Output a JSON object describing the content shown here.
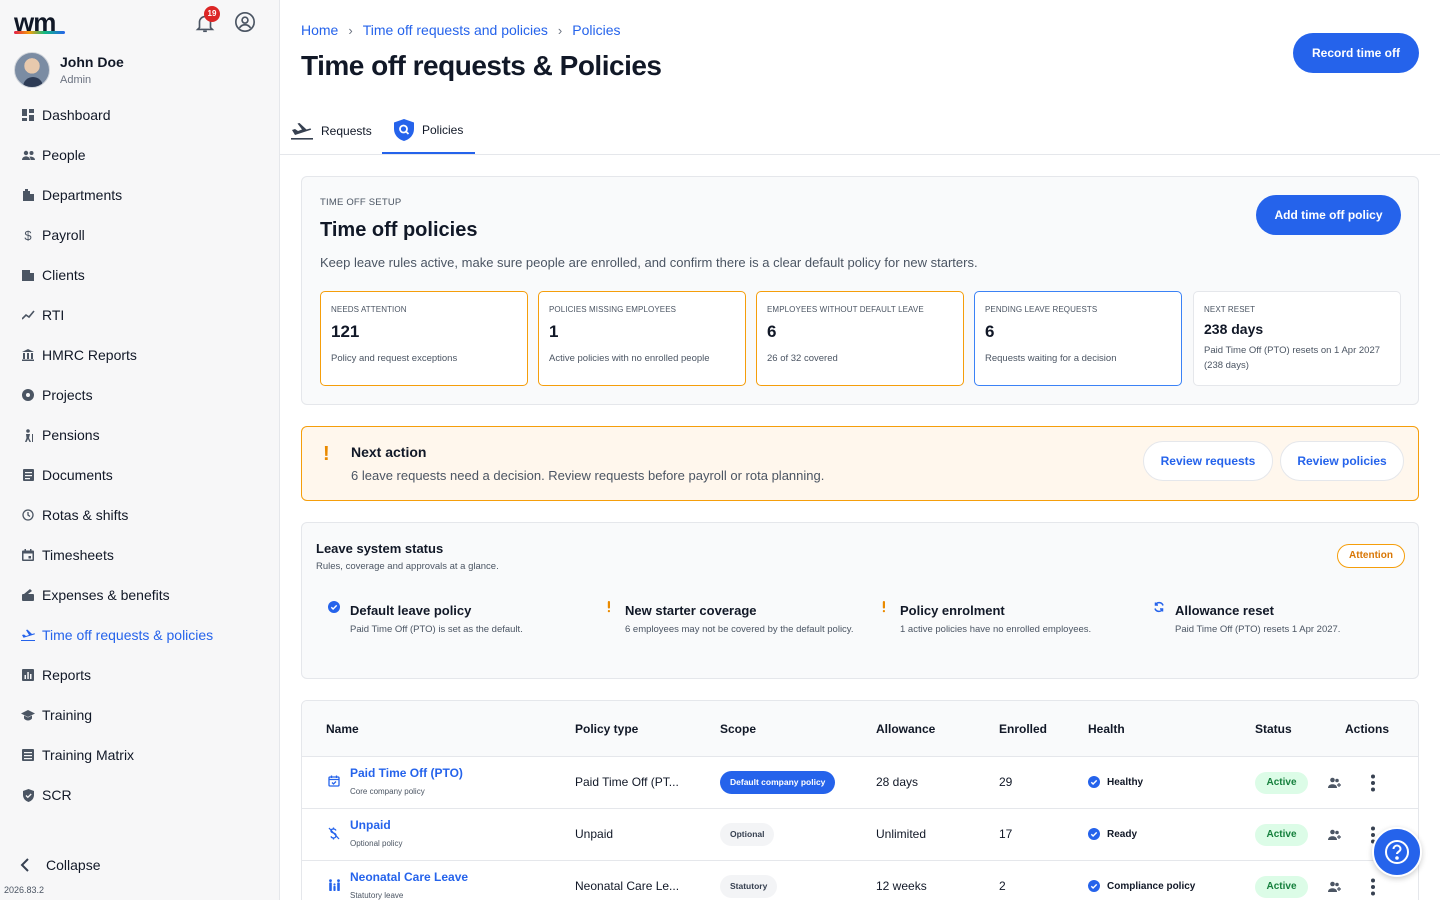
{
  "app": {
    "logo": "wm",
    "notifications_count": "19",
    "version": "2026.83.2"
  },
  "user": {
    "name": "John Doe",
    "role": "Admin"
  },
  "sidebar": {
    "items": [
      {
        "label": "Dashboard",
        "icon": "dashboard-icon"
      },
      {
        "label": "People",
        "icon": "people-icon"
      },
      {
        "label": "Departments",
        "icon": "building-icon"
      },
      {
        "label": "Payroll",
        "icon": "dollar-icon"
      },
      {
        "label": "Clients",
        "icon": "clients-icon"
      },
      {
        "label": "RTI",
        "icon": "trend-icon"
      },
      {
        "label": "HMRC Reports",
        "icon": "bank-icon"
      },
      {
        "label": "Projects",
        "icon": "projects-icon"
      },
      {
        "label": "Pensions",
        "icon": "pensions-icon"
      },
      {
        "label": "Documents",
        "icon": "document-icon"
      },
      {
        "label": "Rotas & shifts",
        "icon": "clock-icon"
      },
      {
        "label": "Timesheets",
        "icon": "calendar-icon"
      },
      {
        "label": "Expenses & benefits",
        "icon": "receipt-icon"
      },
      {
        "label": "Time off requests & policies",
        "icon": "plane-icon",
        "active": true
      },
      {
        "label": "Reports",
        "icon": "reports-icon"
      },
      {
        "label": "Training",
        "icon": "graduation-icon"
      },
      {
        "label": "Training Matrix",
        "icon": "matrix-icon"
      },
      {
        "label": "SCR",
        "icon": "shield-icon"
      }
    ],
    "collapse_label": "Collapse"
  },
  "header": {
    "breadcrumb": [
      "Home",
      "Time off requests and policies",
      "Policies"
    ],
    "title": "Time off requests & Policies",
    "record_button": "Record time off"
  },
  "tabs": [
    {
      "label": "Requests",
      "icon": "plane-icon"
    },
    {
      "label": "Policies",
      "icon": "shield-search-icon",
      "active": true
    }
  ],
  "setup": {
    "eyebrow": "TIME OFF SETUP",
    "title": "Time off policies",
    "description": "Keep leave rules active, make sure people are enrolled, and confirm there is a clear default policy for new starters.",
    "add_button": "Add time off policy",
    "stats": [
      {
        "label": "Needs attention",
        "value": "121",
        "sub": "Policy and request exceptions",
        "tone": "orange"
      },
      {
        "label": "Policies missing employees",
        "value": "1",
        "sub": "Active policies with no enrolled people",
        "tone": "orange"
      },
      {
        "label": "Employees without default leave",
        "value": "6",
        "sub": "26 of 32 covered",
        "tone": "orange"
      },
      {
        "label": "Pending leave requests",
        "value": "6",
        "sub": "Requests waiting for a decision",
        "tone": "blue"
      },
      {
        "label": "Next reset",
        "value": "238 days",
        "sub": "Paid Time Off (PTO) resets on 1 Apr 2027 (238 days)",
        "tone": "neutral"
      }
    ]
  },
  "next_action": {
    "mark": "!",
    "title": "Next action",
    "text": "6 leave requests need a decision. Review requests before payroll or rota planning.",
    "review_requests": "Review requests",
    "review_policies": "Review policies"
  },
  "leave_status": {
    "title": "Leave system status",
    "subtitle": "Rules, coverage and approvals at a glance.",
    "badge": "Attention",
    "items": [
      {
        "name": "Default leave policy",
        "desc": "Paid Time Off (PTO) is set as the default.",
        "icon": "check-circle-icon"
      },
      {
        "name": "New starter coverage",
        "desc": "6 employees may not be covered by the default policy.",
        "icon": "warning-icon"
      },
      {
        "name": "Policy enrolment",
        "desc": "1 active policies have no enrolled employees.",
        "icon": "warning-icon"
      },
      {
        "name": "Allowance reset",
        "desc": "Paid Time Off (PTO) resets 1 Apr 2027.",
        "icon": "refresh-icon"
      }
    ]
  },
  "table": {
    "columns": [
      "Name",
      "Policy type",
      "Scope",
      "Allowance",
      "Enrolled",
      "Health",
      "Status",
      "Actions"
    ],
    "rows": [
      {
        "name": "Paid Time Off (PTO)",
        "sub": "Core company policy",
        "type": "Paid Time Off (PT...",
        "scope": "Default company policy",
        "allowance": "28 days",
        "enrolled": "29",
        "health": "Healthy",
        "status": "Active",
        "icon": "calendar-check-icon"
      },
      {
        "name": "Unpaid",
        "sub": "Optional policy",
        "type": "Unpaid",
        "scope": "Optional",
        "allowance": "Unlimited",
        "enrolled": "17",
        "health": "Ready",
        "status": "Active",
        "icon": "money-off-icon"
      },
      {
        "name": "Neonatal Care Leave",
        "sub": "Statutory leave",
        "type": "Neonatal Care Le...",
        "scope": "Statutory",
        "allowance": "12 weeks",
        "enrolled": "2",
        "health": "Compliance policy",
        "status": "Active",
        "icon": "family-icon"
      }
    ]
  },
  "colors": {
    "accent": "#2563eb",
    "warning": "#f59e0b",
    "success_bg": "#dcfce7",
    "success_text": "#15803d"
  }
}
